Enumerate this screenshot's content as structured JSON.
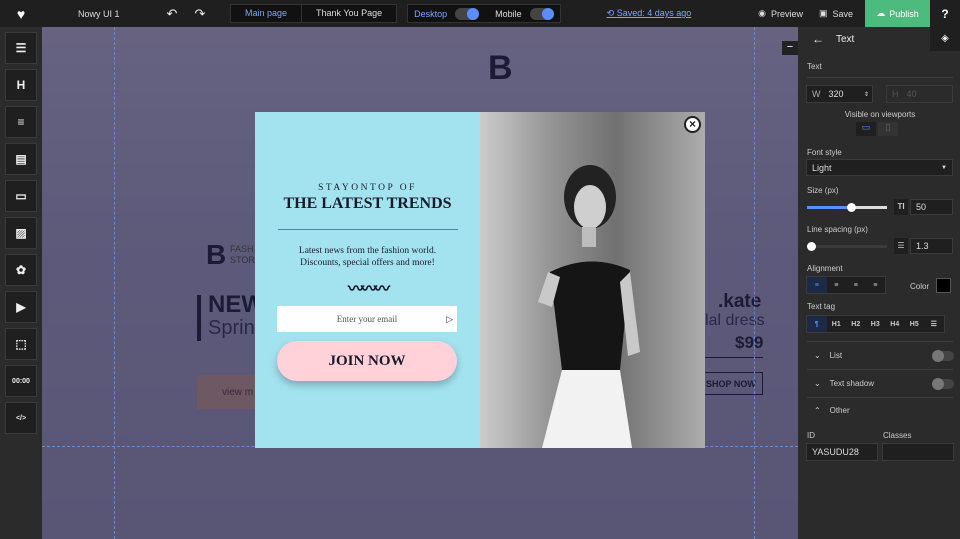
{
  "topbar": {
    "project": "Nowy UI 1",
    "pages": [
      "Main page",
      "Thank You Page"
    ],
    "viewports": [
      "Desktop",
      "Mobile"
    ],
    "saved": "Saved: 4 days ago",
    "preview": "Preview",
    "save": "Save",
    "publish": "Publish",
    "help": "?"
  },
  "leftbar": {
    "items": [
      {
        "icon": "section-icon",
        "glyph": "☰"
      },
      {
        "icon": "heading-icon",
        "glyph": "H"
      },
      {
        "icon": "text-icon",
        "glyph": "≡"
      },
      {
        "icon": "menu-icon",
        "glyph": "▤"
      },
      {
        "icon": "button-icon",
        "glyph": "▭"
      },
      {
        "icon": "image-icon",
        "glyph": "▨"
      },
      {
        "icon": "social-icons-icon",
        "glyph": "✿"
      },
      {
        "icon": "video-icon",
        "glyph": "▶"
      },
      {
        "icon": "frame-icon",
        "glyph": "⬚"
      },
      {
        "icon": "timer-icon",
        "glyph": "00:00"
      },
      {
        "icon": "code-icon",
        "glyph": "</>"
      }
    ]
  },
  "background": {
    "logo": "B",
    "brand_line1": "FASH",
    "brand_line2": "STOR",
    "headline": "NEW",
    "subline": "Spring",
    "view_more": "view m",
    "product_name": ".kate",
    "product_desc": "lal dress",
    "price": "$99",
    "shop_now": "SHOP NOW"
  },
  "popup": {
    "kicker": "STAYONTOP OF",
    "title": "THE LATEST TRENDS",
    "body_line1": "Latest news from the fashion world.",
    "body_line2": "Discounts, special offers and more!",
    "email_placeholder": "Enter your email",
    "cta": "JOIN NOW",
    "colors": {
      "left_bg": "#a3e3f0",
      "cta_bg": "#ffd1d9"
    }
  },
  "panel": {
    "title": "Text",
    "section": "Text",
    "w_label": "W",
    "w_value": "320",
    "h_label": "H",
    "h_value": "40",
    "visible_label": "Visible on viewports",
    "font_style_label": "Font style",
    "font_style_value": "Light",
    "size_label": "Size (px)",
    "size_value": "50",
    "size_slider": 0.55,
    "line_spacing_label": "Line spacing (px)",
    "line_spacing_value": "1.3",
    "line_slider": 0.0,
    "alignment_label": "Alignment",
    "color_label": "Color",
    "color_value": "#000000",
    "text_tag_label": "Text tag",
    "tags": [
      "¶",
      "H1",
      "H2",
      "H3",
      "H4",
      "H5",
      "☰"
    ],
    "list_label": "List",
    "shadow_label": "Text shadow",
    "other_label": "Other",
    "id_label": "ID",
    "id_value": "YASUDU28",
    "classes_label": "Classes",
    "classes_value": ""
  }
}
